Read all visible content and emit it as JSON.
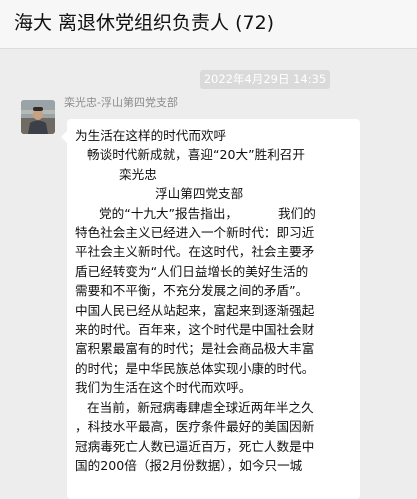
{
  "window": {
    "title": "海大  离退休党组织负责人 (72)"
  },
  "chat": {
    "timestamp": "2022年4月29日  14:35",
    "message": {
      "sender": "栾光忠-浮山第四党支部",
      "lines": [
        "为生活在这样的时代而欢呼",
        "   畅谈时代新成就，喜迎“20大”胜利召开",
        "           栾光忠",
        "                    浮山第四党支部",
        "      党的“十九大”报告指出，          我们的",
        "特色社会主义已经进入一个新时代：即习近",
        "平社会主义新时代。在这时代，社会主要矛",
        "盾已经转变为“人们日益增长的美好生活的",
        "需要和不平衡，不充分发展之间的矛盾”。",
        "中国人民已经从站起来，富起来到逐渐强起",
        "来的时代。百年来，这个时代是中国社会财",
        "富积累最富有的时代；是社会商品极大丰富",
        "的时代；是中华民族总体实现小康的时代。",
        "我们为生活在这个时代而欢呼。",
        "   在当前，新冠病毒肆虐全球近两年半之久",
        "，科技水平最高，医疗条件最好的美国因新",
        "冠病毒死亡人数已逼近百万，死亡人数是中",
        "国的200倍（报2月份数据），如今只一城"
      ]
    }
  },
  "colors": {
    "background": "#ededed",
    "bubble": "#ffffff",
    "timestamp_badge": "#dadada"
  }
}
